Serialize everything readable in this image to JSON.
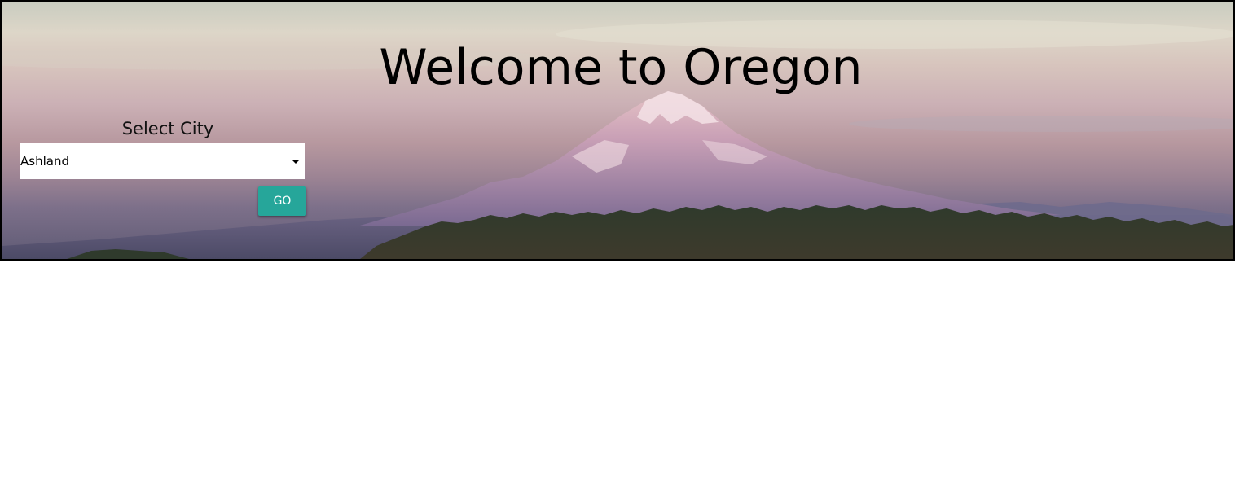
{
  "hero": {
    "title": "Welcome to Oregon",
    "background_image": "mount-hood-landscape"
  },
  "city_selector": {
    "label": "Select City",
    "selected_value": "Ashland",
    "go_label": "GO"
  },
  "colors": {
    "go_button": "#26a69a",
    "hero_border": "#000000",
    "page_background": "#ffffff"
  }
}
